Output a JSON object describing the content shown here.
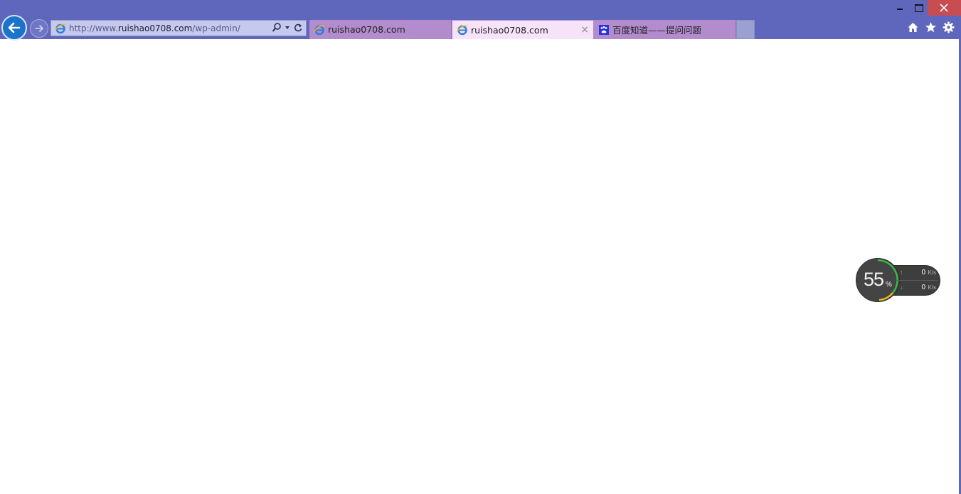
{
  "window": {
    "caption": {
      "minimize": "minimize",
      "maximize": "maximize",
      "close": "close"
    }
  },
  "nav": {
    "address": {
      "prefix": "http://www.",
      "domain": "ruishao0708.com",
      "path": "/wp-admin/"
    }
  },
  "tabs": [
    {
      "label": "ruishao0708.com",
      "icon": "ie-icon",
      "active": false
    },
    {
      "label": "ruishao0708.com",
      "icon": "ie-icon",
      "active": true,
      "close_glyph": "×"
    },
    {
      "label": "百度知道——提问问题",
      "icon": "baidu-paw-icon",
      "active": false
    }
  ],
  "toolbar": {
    "icons": [
      "home-icon",
      "star-icon",
      "gear-icon"
    ]
  },
  "speed_widget": {
    "percent_value": "55",
    "percent_symbol": "%",
    "percent": 55,
    "upload": {
      "value": "0",
      "unit": "K/s",
      "arrow": "↑"
    },
    "download": {
      "value": "0",
      "unit": "K/s",
      "arrow": "↓"
    },
    "colors": {
      "ring_green": "#35c24a",
      "ring_yellow": "#e9c21c",
      "arrow_up": "#f2882d",
      "arrow_down": "#3ac24e"
    }
  },
  "colors": {
    "chrome": "#5f67bd",
    "tab_inactive": "#b38ccd",
    "tab_active": "#f6e3f9",
    "close_button": "#c74d53",
    "back_button": "#1b74c9"
  }
}
